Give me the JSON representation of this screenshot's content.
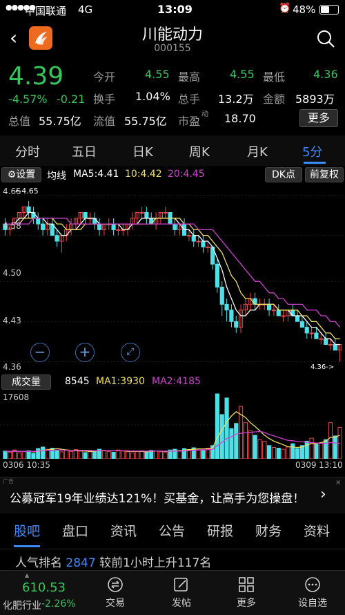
{
  "status_bar": {
    "signal": "●●●●●",
    "carrier": "中国联通",
    "network": "4G",
    "time": "13:09",
    "battery": "48%"
  },
  "header": {
    "title": "川能动力",
    "code": "000155"
  },
  "quote": {
    "price": "4.39",
    "change_pct": "-4.57%",
    "change": "-0.21",
    "open_label": "今开",
    "open": "4.55",
    "high_label": "最高",
    "high": "4.55",
    "low_label": "最低",
    "low": "4.36",
    "turnover_label": "换手",
    "turnover": "1.04%",
    "volume_label": "总手",
    "volume": "13.2万",
    "amount_label": "金额",
    "amount": "5893万",
    "mktcap_label": "总值",
    "mktcap": "55.75亿",
    "float_label": "流值",
    "float": "55.75亿",
    "pe_label": "市盈",
    "pe_sup": "动",
    "pe": "18.70",
    "more": "更多"
  },
  "tabs": [
    "分时",
    "五日",
    "日K",
    "周K",
    "月K",
    "5分"
  ],
  "active_tab_index": 5,
  "indicator_bar": {
    "settings": "设置",
    "ma_label": "均线",
    "ma5": "MA5:4.41",
    "ma10": "10:4.42",
    "ma20": "20:4.45",
    "dk": "DK点",
    "fq": "前复权"
  },
  "price_axis": [
    "4.65",
    "4.58",
    "4.50",
    "4.43",
    "4.36"
  ],
  "high_marker": "4.65",
  "low_marker": "4.36->",
  "volume_bar": {
    "label": "成交量",
    "value": "8545",
    "ma1": "MA1:3930",
    "ma2": "MA2:4185"
  },
  "volume_max": "17608",
  "time_axis": {
    "start": "0306 10:35",
    "end_date": "0309",
    "end_time": "13:10"
  },
  "ad": {
    "tag": "广告",
    "text": "公募冠军19年业绩达121%！买基金，让高手为您操盘！"
  },
  "bottom_tabs": [
    "股吧",
    "盘口",
    "资讯",
    "公告",
    "研报",
    "财务",
    "资料"
  ],
  "active_bottom_index": 0,
  "rank": {
    "label": "人气排名",
    "value": "2847",
    "desc": "较前1小时上升117名"
  },
  "footer": {
    "index_value": "610.53",
    "index_name": "化肥行业",
    "index_change": "-2.26%",
    "trade": "交易",
    "post": "发帖",
    "more": "更多",
    "watch": "设自选"
  },
  "colors": {
    "up": "#f04848",
    "down": "#4ee0e8",
    "ma5": "#ffffff",
    "ma10": "#f0e060",
    "ma20": "#d040d0",
    "accent": "#3d8bff",
    "green": "#35c759"
  },
  "chart_data": {
    "type": "candlestick",
    "candles": [
      [
        4.6,
        4.61,
        4.58,
        4.59
      ],
      [
        4.59,
        4.6,
        4.58,
        4.6
      ],
      [
        4.6,
        4.61,
        4.59,
        4.61
      ],
      [
        4.61,
        4.62,
        4.6,
        4.62
      ],
      [
        4.62,
        4.63,
        4.61,
        4.63
      ],
      [
        4.63,
        4.64,
        4.61,
        4.62
      ],
      [
        4.62,
        4.63,
        4.6,
        4.61
      ],
      [
        4.61,
        4.62,
        4.59,
        4.6
      ],
      [
        4.6,
        4.61,
        4.58,
        4.59
      ],
      [
        4.59,
        4.61,
        4.58,
        4.6
      ],
      [
        4.6,
        4.61,
        4.58,
        4.58
      ],
      [
        4.58,
        4.59,
        4.56,
        4.57
      ],
      [
        4.57,
        4.58,
        4.55,
        4.58
      ],
      [
        4.58,
        4.6,
        4.57,
        4.59
      ],
      [
        4.59,
        4.61,
        4.58,
        4.6
      ],
      [
        4.6,
        4.61,
        4.59,
        4.61
      ],
      [
        4.61,
        4.62,
        4.6,
        4.62
      ],
      [
        4.62,
        4.62,
        4.6,
        4.61
      ],
      [
        4.61,
        4.62,
        4.6,
        4.61
      ],
      [
        4.61,
        4.62,
        4.59,
        4.6
      ],
      [
        4.6,
        4.61,
        4.58,
        4.59
      ],
      [
        4.59,
        4.6,
        4.58,
        4.6
      ],
      [
        4.6,
        4.61,
        4.59,
        4.6
      ],
      [
        4.6,
        4.61,
        4.58,
        4.59
      ],
      [
        4.59,
        4.6,
        4.58,
        4.59
      ],
      [
        4.59,
        4.6,
        4.58,
        4.59
      ],
      [
        4.59,
        4.6,
        4.58,
        4.6
      ],
      [
        4.6,
        4.62,
        4.59,
        4.61
      ],
      [
        4.61,
        4.62,
        4.6,
        4.62
      ],
      [
        4.62,
        4.63,
        4.61,
        4.62
      ],
      [
        4.62,
        4.63,
        4.6,
        4.61
      ],
      [
        4.61,
        4.62,
        4.6,
        4.6
      ],
      [
        4.6,
        4.62,
        4.59,
        4.61
      ],
      [
        4.61,
        4.62,
        4.6,
        4.62
      ],
      [
        4.62,
        4.63,
        4.61,
        4.62
      ],
      [
        4.62,
        4.62,
        4.6,
        4.6
      ],
      [
        4.6,
        4.61,
        4.58,
        4.59
      ],
      [
        4.59,
        4.6,
        4.58,
        4.6
      ],
      [
        4.6,
        4.61,
        4.58,
        4.58
      ],
      [
        4.58,
        4.59,
        4.57,
        4.58
      ],
      [
        4.58,
        4.59,
        4.56,
        4.57
      ],
      [
        4.57,
        4.58,
        4.56,
        4.57
      ],
      [
        4.57,
        4.58,
        4.55,
        4.56
      ],
      [
        4.56,
        4.57,
        4.55,
        4.56
      ],
      [
        4.56,
        4.56,
        4.52,
        4.53
      ],
      [
        4.53,
        4.54,
        4.48,
        4.49
      ],
      [
        4.49,
        4.5,
        4.44,
        4.46
      ],
      [
        4.46,
        4.47,
        4.43,
        4.45
      ],
      [
        4.45,
        4.46,
        4.42,
        4.43
      ],
      [
        4.43,
        4.44,
        4.41,
        4.42
      ],
      [
        4.42,
        4.46,
        4.41,
        4.45
      ],
      [
        4.45,
        4.47,
        4.44,
        4.46
      ],
      [
        4.46,
        4.48,
        4.45,
        4.47
      ],
      [
        4.47,
        4.48,
        4.45,
        4.46
      ],
      [
        4.46,
        4.47,
        4.45,
        4.46
      ],
      [
        4.46,
        4.47,
        4.45,
        4.46
      ],
      [
        4.46,
        4.47,
        4.44,
        4.45
      ],
      [
        4.45,
        4.46,
        4.44,
        4.45
      ],
      [
        4.45,
        4.46,
        4.44,
        4.44
      ],
      [
        4.44,
        4.45,
        4.43,
        4.44
      ],
      [
        4.44,
        4.45,
        4.43,
        4.45
      ],
      [
        4.45,
        4.46,
        4.44,
        4.44
      ],
      [
        4.44,
        4.45,
        4.43,
        4.43
      ],
      [
        4.43,
        4.44,
        4.42,
        4.42
      ],
      [
        4.42,
        4.43,
        4.4,
        4.41
      ],
      [
        4.41,
        4.42,
        4.4,
        4.41
      ],
      [
        4.41,
        4.42,
        4.4,
        4.4
      ],
      [
        4.4,
        4.41,
        4.39,
        4.4
      ],
      [
        4.4,
        4.41,
        4.39,
        4.39
      ],
      [
        4.39,
        4.4,
        4.38,
        4.39
      ],
      [
        4.39,
        4.4,
        4.38,
        4.38
      ],
      [
        4.38,
        4.39,
        4.36,
        4.39
      ]
    ],
    "volume": [
      2100,
      1800,
      2400,
      1600,
      2000,
      2200,
      1500,
      2800,
      3200,
      2600,
      2900,
      2400,
      1900,
      2300,
      2000,
      2500,
      2100,
      1700,
      1900,
      2200,
      2600,
      2300,
      2000,
      1800,
      2400,
      2100,
      1900,
      1600,
      2000,
      2200,
      1800,
      2300,
      2100,
      1900,
      1700,
      2400,
      2600,
      2200,
      2800,
      2500,
      3000,
      2700,
      2400,
      2900,
      3600,
      17608,
      12000,
      16500,
      8200,
      9600,
      14200,
      9800,
      7600,
      6400,
      5200,
      4800,
      3600,
      3100,
      2900,
      2600,
      3200,
      4100,
      2800,
      3600,
      4800,
      5600,
      3900,
      4400,
      5200,
      9800,
      6200,
      8545
    ],
    "ma5": [
      4.6,
      4.6,
      4.6,
      4.61,
      4.61,
      4.62,
      4.62,
      4.61,
      4.61,
      4.6,
      4.6,
      4.59,
      4.58,
      4.58,
      4.59,
      4.59,
      4.6,
      4.61,
      4.61,
      4.61,
      4.6,
      4.6,
      4.6,
      4.6,
      4.6,
      4.59,
      4.59,
      4.6,
      4.6,
      4.61,
      4.61,
      4.61,
      4.61,
      4.61,
      4.61,
      4.61,
      4.61,
      4.6,
      4.59,
      4.59,
      4.58,
      4.58,
      4.57,
      4.57,
      4.56,
      4.54,
      4.52,
      4.49,
      4.47,
      4.45,
      4.44,
      4.44,
      4.45,
      4.45,
      4.46,
      4.46,
      4.46,
      4.46,
      4.45,
      4.45,
      4.45,
      4.44,
      4.44,
      4.44,
      4.43,
      4.42,
      4.42,
      4.41,
      4.4,
      4.4,
      4.39,
      4.39
    ],
    "ma10": [
      4.6,
      4.6,
      4.6,
      4.6,
      4.61,
      4.61,
      4.61,
      4.61,
      4.61,
      4.61,
      4.61,
      4.6,
      4.6,
      4.59,
      4.59,
      4.59,
      4.59,
      4.6,
      4.6,
      4.6,
      4.6,
      4.6,
      4.6,
      4.6,
      4.6,
      4.6,
      4.6,
      4.6,
      4.6,
      4.6,
      4.6,
      4.6,
      4.61,
      4.61,
      4.61,
      4.61,
      4.61,
      4.61,
      4.6,
      4.6,
      4.59,
      4.59,
      4.58,
      4.58,
      4.57,
      4.56,
      4.55,
      4.53,
      4.51,
      4.5,
      4.48,
      4.47,
      4.47,
      4.46,
      4.46,
      4.46,
      4.46,
      4.46,
      4.45,
      4.45,
      4.45,
      4.45,
      4.45,
      4.44,
      4.44,
      4.43,
      4.43,
      4.42,
      4.41,
      4.41,
      4.4,
      4.4
    ],
    "ma20": [
      4.6,
      4.6,
      4.6,
      4.6,
      4.6,
      4.6,
      4.61,
      4.61,
      4.61,
      4.61,
      4.61,
      4.61,
      4.61,
      4.61,
      4.6,
      4.6,
      4.6,
      4.6,
      4.6,
      4.6,
      4.6,
      4.6,
      4.6,
      4.6,
      4.6,
      4.6,
      4.6,
      4.6,
      4.6,
      4.6,
      4.6,
      4.6,
      4.6,
      4.6,
      4.6,
      4.6,
      4.6,
      4.6,
      4.6,
      4.6,
      4.6,
      4.59,
      4.59,
      4.59,
      4.59,
      4.58,
      4.57,
      4.56,
      4.55,
      4.54,
      4.53,
      4.52,
      4.51,
      4.5,
      4.5,
      4.49,
      4.48,
      4.48,
      4.47,
      4.47,
      4.46,
      4.46,
      4.46,
      4.46,
      4.45,
      4.45,
      4.45,
      4.44,
      4.44,
      4.43,
      4.43,
      4.42
    ],
    "vol_ma1": [
      2100,
      2000,
      2100,
      2000,
      2000,
      2000,
      1900,
      2000,
      2300,
      2400,
      2600,
      2800,
      2600,
      2400,
      2300,
      2200,
      2200,
      2100,
      2000,
      2100,
      2200,
      2200,
      2200,
      2200,
      2200,
      2200,
      2100,
      2000,
      2000,
      2000,
      1900,
      2000,
      2100,
      2100,
      2000,
      2100,
      2200,
      2200,
      2300,
      2500,
      2600,
      2700,
      2700,
      2700,
      2900,
      5800,
      7800,
      10000,
      11600,
      12800,
      12000,
      11200,
      9800,
      8800,
      7600,
      6400,
      5500,
      4800,
      4300,
      3800,
      3300,
      3200,
      3100,
      3200,
      3700,
      4200,
      4100,
      4400,
      4800,
      5800,
      5900,
      6400
    ],
    "vol_ma2": [
      2100,
      2000,
      2000,
      2000,
      2000,
      2000,
      2000,
      2100,
      2200,
      2300,
      2300,
      2400,
      2400,
      2300,
      2300,
      2300,
      2300,
      2300,
      2300,
      2200,
      2200,
      2200,
      2200,
      2200,
      2200,
      2200,
      2200,
      2100,
      2100,
      2100,
      2100,
      2100,
      2100,
      2100,
      2100,
      2100,
      2100,
      2100,
      2200,
      2200,
      2300,
      2400,
      2400,
      2500,
      2600,
      3600,
      4500,
      5500,
      6000,
      6700,
      6900,
      7100,
      7200,
      7300,
      7400,
      7200,
      6600,
      6200,
      5800,
      5400,
      5000,
      4900,
      4700,
      4600,
      4500,
      4400,
      4300,
      4200,
      4200,
      4400,
      4300,
      4185
    ],
    "price_range": [
      4.34,
      4.67
    ]
  }
}
